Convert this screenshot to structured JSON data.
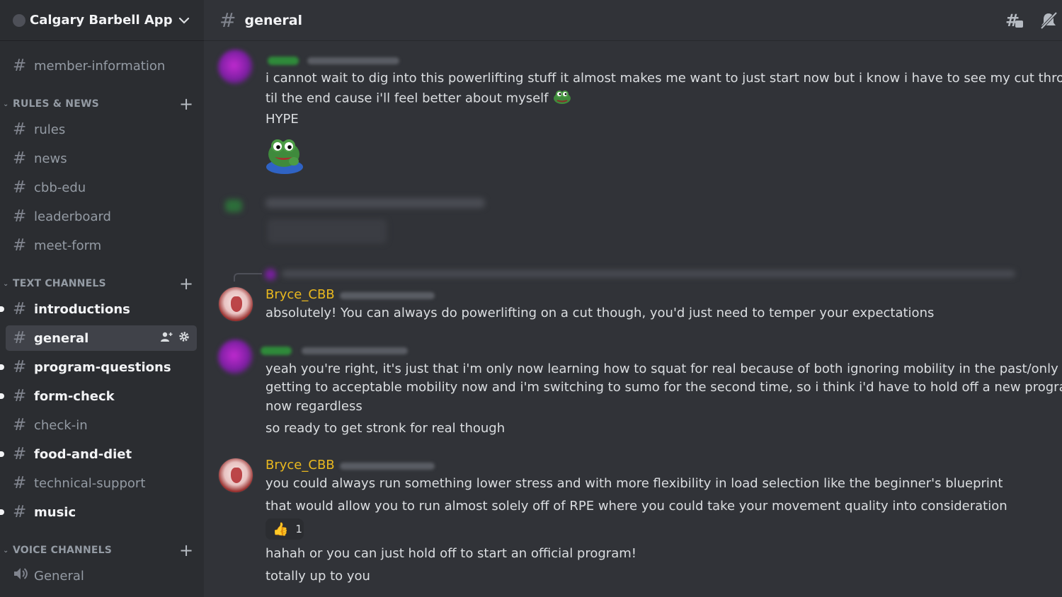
{
  "server": {
    "name": "Calgary Barbell App"
  },
  "sidebar": {
    "top_channels": [
      {
        "name": "member-information"
      }
    ],
    "categories": [
      {
        "name": "RULES & NEWS",
        "channels": [
          {
            "name": "rules"
          },
          {
            "name": "news"
          },
          {
            "name": "cbb-edu"
          },
          {
            "name": "leaderboard"
          },
          {
            "name": "meet-form"
          }
        ]
      },
      {
        "name": "TEXT CHANNELS",
        "channels": [
          {
            "name": "introductions",
            "unread": true
          },
          {
            "name": "general",
            "active": true
          },
          {
            "name": "program-questions",
            "unread": true
          },
          {
            "name": "form-check",
            "unread": true
          },
          {
            "name": "check-in"
          },
          {
            "name": "food-and-diet",
            "unread": true
          },
          {
            "name": "technical-support"
          },
          {
            "name": "music",
            "unread": true
          }
        ]
      },
      {
        "name": "VOICE CHANNELS",
        "channels": [
          {
            "name": "General",
            "voice": true
          }
        ]
      }
    ]
  },
  "header": {
    "channel_name": "general",
    "icons": [
      "threads-icon",
      "notifications-muted-icon"
    ]
  },
  "messages": [
    {
      "author": "",
      "lines": [
        "i cannot wait to dig into this powerlifting stuff it almost makes me want to just start now but i know i have to see my cut through",
        "til the end cause i'll feel better about myself",
        "HYPE"
      ]
    },
    {
      "author": "Bryce_CBB",
      "lines": [
        "absolutely!  You can always do powerlifting on a cut though, you'd just need to temper your expectations"
      ]
    },
    {
      "author": "",
      "lines": [
        "yeah you're right, it's just that i'm only now learning how to squat for real because of both ignoring mobility in the past/only",
        "getting to acceptable mobility now and i'm switching to sumo for the second time, so i think i'd have to hold off a new program for",
        "now regardless",
        "so ready to get stronk for real though"
      ]
    },
    {
      "author": "Bryce_CBB",
      "lines": [
        "you could always run something lower stress and with more flexibility in load selection like the beginner's blueprint",
        "that would allow you to run almost solely off of RPE where you could take your movement quality into consideration",
        "hahah or you can just hold off to start an official program!",
        "totally up to you"
      ],
      "reaction": {
        "emoji": "👍",
        "count": "1"
      }
    }
  ],
  "colors": {
    "username": "#e9b81f",
    "background": "#313338",
    "sidebar": "#2b2d31"
  }
}
